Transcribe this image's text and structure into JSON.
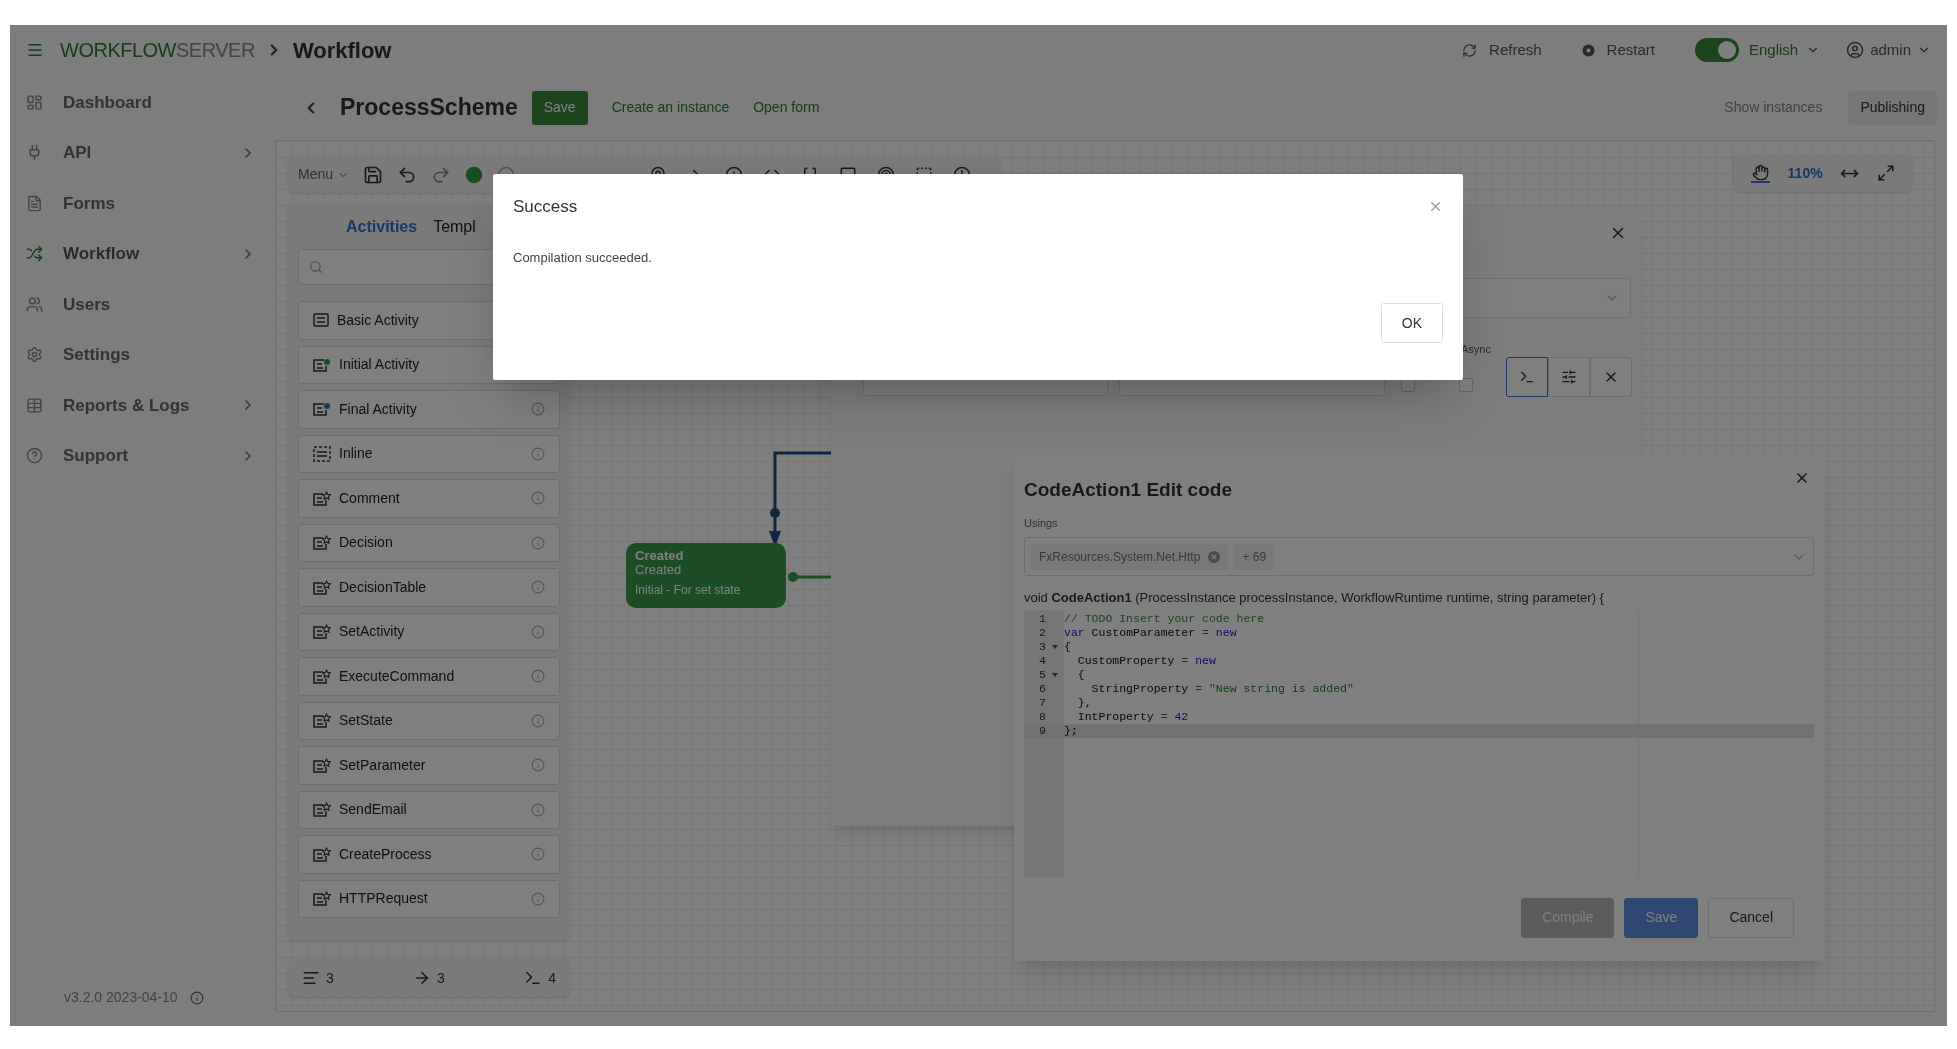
{
  "header": {
    "brand_primary": "WORKFLOW",
    "brand_secondary": "SERVER",
    "breadcrumb": "Workflow",
    "actions": [
      "Refresh",
      "Restart"
    ],
    "theme_toggle": {
      "on": true
    },
    "language": "English",
    "user": "admin"
  },
  "sidebar": {
    "items": [
      {
        "label": "Dashboard",
        "expandable": false,
        "selected": false
      },
      {
        "label": "API",
        "expandable": true,
        "selected": false
      },
      {
        "label": "Forms",
        "expandable": false,
        "selected": false
      },
      {
        "label": "Workflow",
        "expandable": true,
        "selected": true
      },
      {
        "label": "Users",
        "expandable": false,
        "selected": false
      },
      {
        "label": "Settings",
        "expandable": false,
        "selected": false
      },
      {
        "label": "Reports & Logs",
        "expandable": true,
        "selected": false
      },
      {
        "label": "Support",
        "expandable": true,
        "selected": false
      }
    ],
    "version": "v3.2.0 2023-04-10"
  },
  "scheme_bar": {
    "title": "ProcessScheme",
    "save": "Save",
    "links": [
      "Create an instance",
      "Open form"
    ],
    "right_actions": [
      {
        "label": "Show instances",
        "selected": false
      },
      {
        "label": "Publishing",
        "selected": true
      }
    ]
  },
  "toolbar": {
    "menu": "Menu"
  },
  "zoom": {
    "level": "110%"
  },
  "elements_panel": {
    "tabs": [
      {
        "label": "Activities",
        "selected": true
      },
      {
        "label": "Templ",
        "selected": false
      }
    ],
    "items": [
      {
        "label": "Basic Activity",
        "kind": "basic"
      },
      {
        "label": "Initial Activity",
        "kind": "initial"
      },
      {
        "label": "Final Activity",
        "kind": "final"
      },
      {
        "label": "Inline",
        "kind": "inline"
      },
      {
        "label": "Comment",
        "kind": "custom"
      },
      {
        "label": "Decision",
        "kind": "custom"
      },
      {
        "label": "DecisionTable",
        "kind": "custom"
      },
      {
        "label": "SetActivity",
        "kind": "custom"
      },
      {
        "label": "ExecuteCommand",
        "kind": "custom"
      },
      {
        "label": "SetState",
        "kind": "custom"
      },
      {
        "label": "SetParameter",
        "kind": "custom"
      },
      {
        "label": "SendEmail",
        "kind": "custom"
      },
      {
        "label": "CreateProcess",
        "kind": "custom"
      },
      {
        "label": "HTTPRequest",
        "kind": "custom"
      }
    ]
  },
  "counters": [
    {
      "kind": "activities",
      "count": "3"
    },
    {
      "kind": "transitions",
      "count": "3"
    },
    {
      "kind": "actions",
      "count": "4"
    }
  ],
  "diagram": {
    "node": {
      "name": "Created",
      "state": "Created",
      "description": "Initial - For set state"
    }
  },
  "actions_panel": {
    "async_label": "Async",
    "checkboxes": [
      {
        "checked": false
      },
      {
        "checked": false
      }
    ]
  },
  "code_dialog": {
    "title": "CodeAction1 Edit code",
    "usings_label": "Usings",
    "using_tag": "FxResources.System.Net.Http",
    "more": "+ 69",
    "signature": "void **CodeAction1** (ProcessInstance processInstance, WorkflowRuntime runtime, string parameter) {",
    "lines": [
      {
        "number": "1",
        "foldable": false,
        "active": false,
        "tokens": [
          {
            "kind": "comment",
            "text": "// TODO Insert your code here"
          }
        ]
      },
      {
        "number": "2",
        "foldable": false,
        "active": false,
        "tokens": [
          {
            "kind": "keyword",
            "text": "var"
          },
          {
            "kind": "plain",
            "text": " CustomParameter "
          },
          {
            "kind": "operator",
            "text": "="
          },
          {
            "kind": "keyword",
            "text": " new"
          }
        ]
      },
      {
        "number": "3",
        "foldable": true,
        "active": false,
        "tokens": [
          {
            "kind": "plain",
            "text": "{"
          }
        ]
      },
      {
        "number": "4",
        "foldable": false,
        "active": false,
        "tokens": [
          {
            "kind": "plain",
            "text": "  CustomProperty "
          },
          {
            "kind": "operator",
            "text": "="
          },
          {
            "kind": "keyword",
            "text": " new"
          }
        ]
      },
      {
        "number": "5",
        "foldable": true,
        "active": false,
        "tokens": [
          {
            "kind": "plain",
            "text": "  {"
          }
        ]
      },
      {
        "number": "6",
        "foldable": false,
        "active": false,
        "tokens": [
          {
            "kind": "plain",
            "text": "    StringProperty "
          },
          {
            "kind": "operator",
            "text": "="
          },
          {
            "kind": "string",
            "text": " \"New string is added\""
          }
        ]
      },
      {
        "number": "7",
        "foldable": false,
        "active": false,
        "tokens": [
          {
            "kind": "plain",
            "text": "  },"
          }
        ]
      },
      {
        "number": "8",
        "foldable": false,
        "active": false,
        "tokens": [
          {
            "kind": "plain",
            "text": "  IntProperty "
          },
          {
            "kind": "operator",
            "text": "="
          },
          {
            "kind": "number",
            "text": " 42"
          }
        ]
      },
      {
        "number": "9",
        "foldable": false,
        "active": true,
        "tokens": [
          {
            "kind": "plain",
            "text": "};"
          }
        ]
      }
    ],
    "buttons": [
      {
        "label": "Compile",
        "kind": "secondary"
      },
      {
        "label": "Save",
        "kind": "primary"
      },
      {
        "label": "Cancel",
        "kind": "default"
      }
    ]
  },
  "success_modal": {
    "title": "Success",
    "message": "Compilation succeeded.",
    "button": "OK"
  }
}
